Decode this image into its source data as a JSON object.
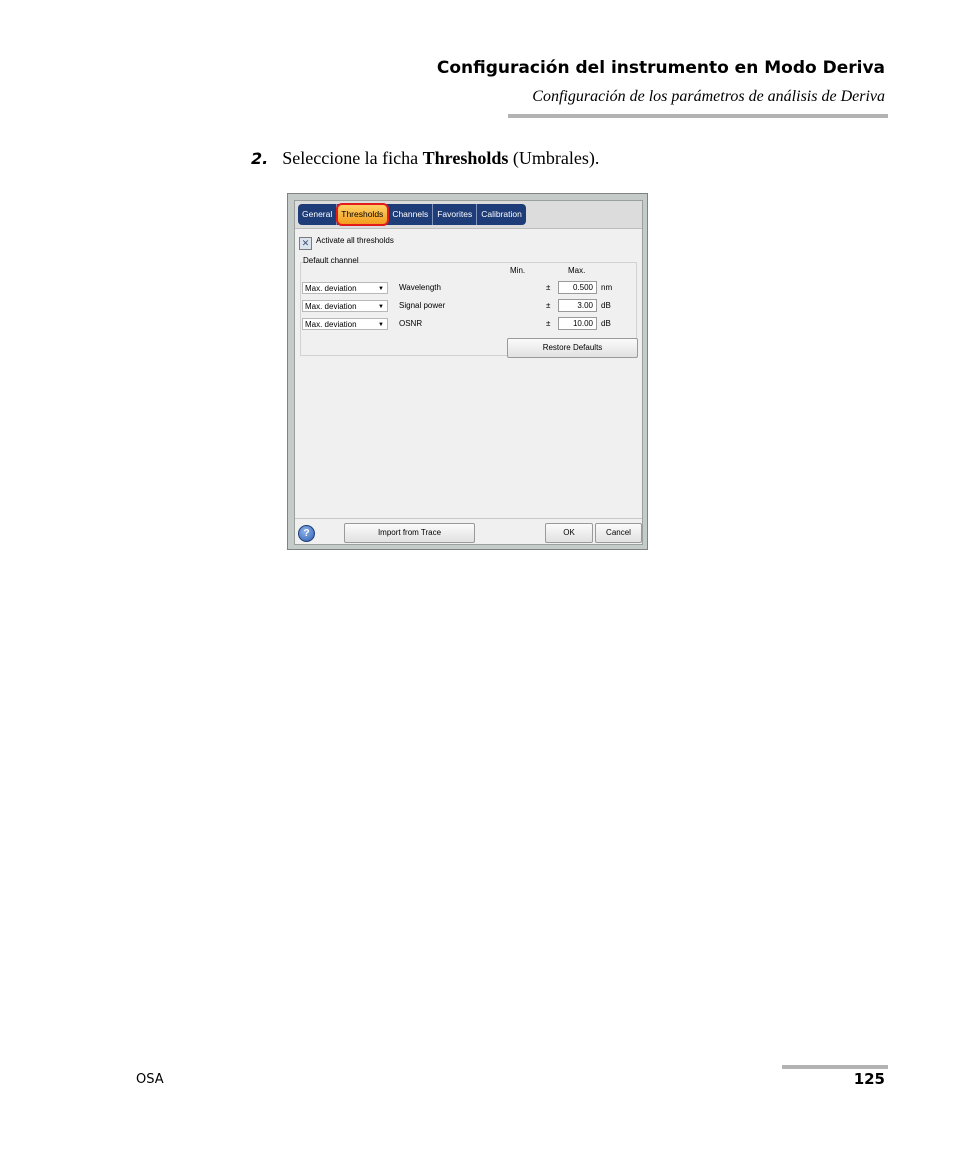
{
  "header": {
    "title": "Configuración del instrumento en Modo Deriva",
    "subtitle": "Configuración de los parámetros de análisis de Deriva"
  },
  "step": {
    "number": "2.",
    "text_before": "Seleccione la ficha ",
    "bold": "Thresholds",
    "text_after": " (Umbrales)."
  },
  "dialog": {
    "tabs": [
      "General",
      "Thresholds",
      "Channels",
      "Favorites",
      "Calibration"
    ],
    "active_tab": "Thresholds",
    "activate_all_label": "Activate all thresholds",
    "activate_all_checked": true,
    "group_label": "Default channel",
    "col_min": "Min.",
    "col_max": "Max.",
    "rows": [
      {
        "mode": "Max. deviation",
        "param": "Wavelength",
        "pm": "±",
        "value": "0.500",
        "unit": "nm"
      },
      {
        "mode": "Max. deviation",
        "param": "Signal power",
        "pm": "±",
        "value": "3.00",
        "unit": "dB"
      },
      {
        "mode": "Max. deviation",
        "param": "OSNR",
        "pm": "±",
        "value": "10.00",
        "unit": "dB"
      }
    ],
    "restore_defaults": "Restore Defaults",
    "help_glyph": "?",
    "import_from_trace": "Import from Trace",
    "ok": "OK",
    "cancel": "Cancel"
  },
  "footer": {
    "left": "OSA",
    "page": "125"
  }
}
